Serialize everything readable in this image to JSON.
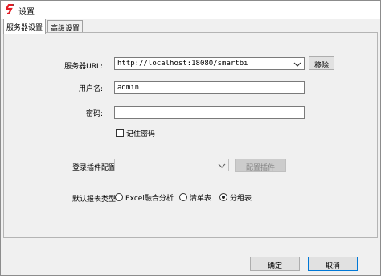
{
  "window": {
    "title": "设置"
  },
  "tabs": [
    {
      "label": "服务器设置",
      "active": true
    },
    {
      "label": "高级设置",
      "active": false
    }
  ],
  "server": {
    "url_label": "服务器URL:",
    "url_value": "http://localhost:18080/smartbi",
    "remove_label": "移除",
    "username_label": "用户名:",
    "username_value": "admin",
    "password_label": "密码:",
    "password_value": "",
    "remember_label": "记住密码",
    "remember_checked": false
  },
  "login_plugin": {
    "label": "登录插件配置:",
    "value": "",
    "configure_label": "配置插件"
  },
  "report_type": {
    "label": "默认报表类型:",
    "options": [
      {
        "label": "Excel融合分析",
        "selected": false
      },
      {
        "label": "清单表",
        "selected": false
      },
      {
        "label": "分组表",
        "selected": true
      }
    ]
  },
  "footer": {
    "ok_label": "确定",
    "cancel_label": "取消"
  },
  "colors": {
    "accent": "#0078d7",
    "logo": "#e31b23"
  }
}
